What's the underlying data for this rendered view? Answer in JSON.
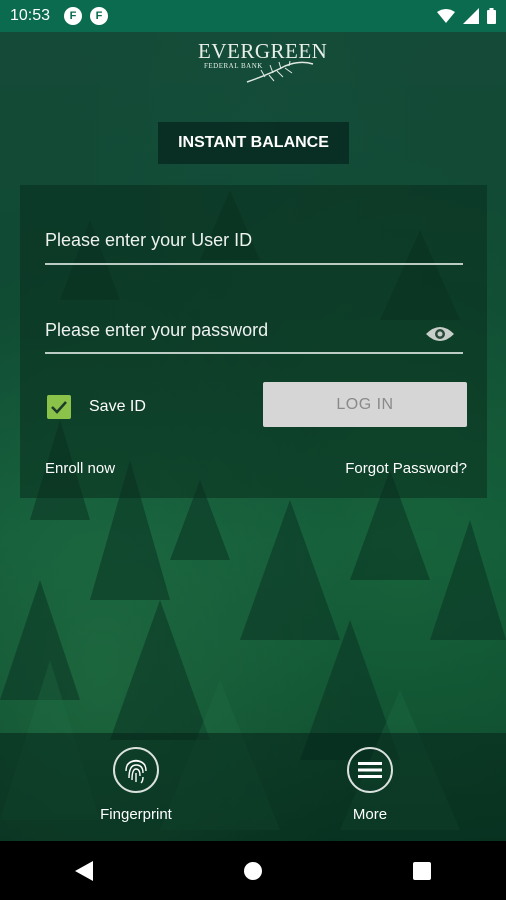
{
  "status_bar": {
    "time": "10:53",
    "app_icon_letter": "F"
  },
  "logo": {
    "name": "EVERGREEN",
    "sub": "FEDERAL BANK"
  },
  "header": {
    "button_label": "INSTANT BALANCE"
  },
  "login": {
    "userid_placeholder": "Please enter your User ID",
    "password_placeholder": "Please enter your password",
    "save_id_label": "Save ID",
    "save_id_checked": true,
    "login_label": "LOG IN",
    "enroll_label": "Enroll now",
    "forgot_label": "Forgot Password?"
  },
  "bottom_bar": {
    "fingerprint_label": "Fingerprint",
    "more_label": "More"
  },
  "colors": {
    "status_bar": "#0a6b4e",
    "checkbox": "#8bc34a",
    "login_button": "#d6d6d6"
  }
}
